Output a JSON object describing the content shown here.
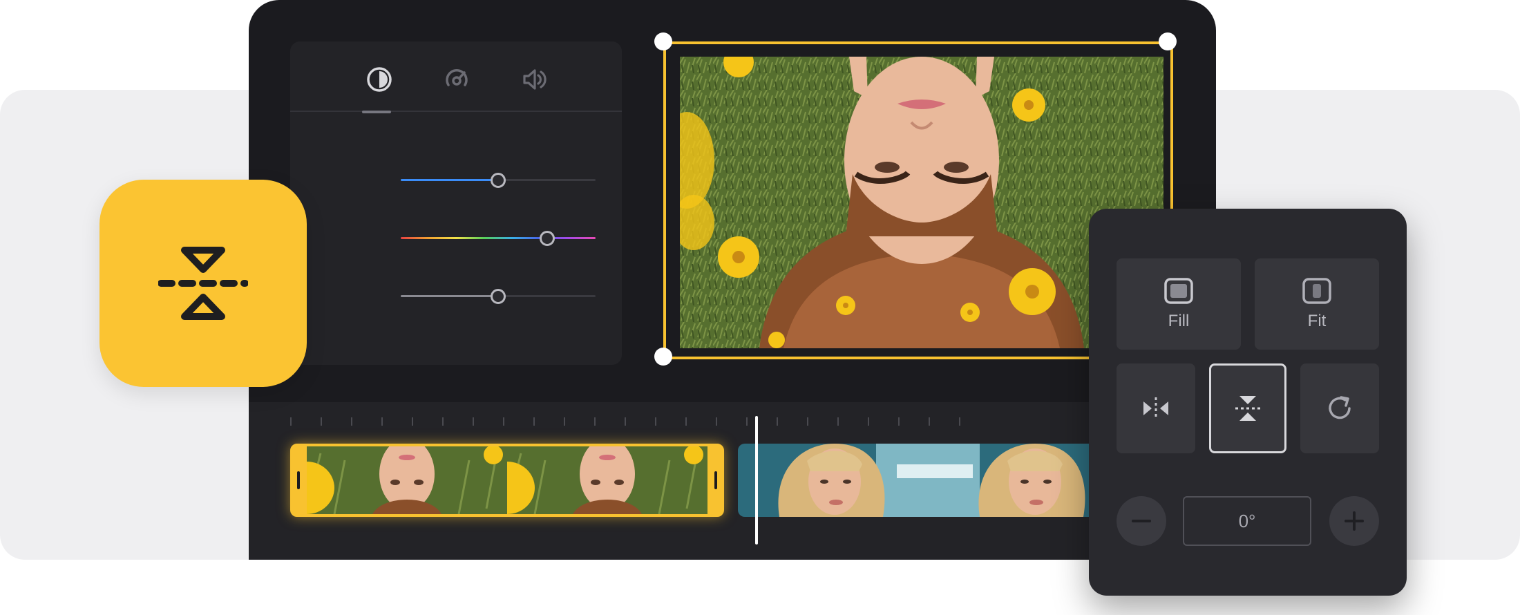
{
  "adjust_panel": {
    "tabs": [
      {
        "icon": "contrast-icon",
        "active": true
      },
      {
        "icon": "speed-icon",
        "active": false
      },
      {
        "icon": "volume-icon",
        "active": false
      }
    ],
    "sliders": [
      {
        "name": "blue-slider",
        "value": 0.5,
        "accent": "#3b8cf7"
      },
      {
        "name": "hue-slider",
        "value": 0.75,
        "accent": "gradient"
      },
      {
        "name": "gray-slider",
        "value": 0.5,
        "accent": "#8a8a92"
      }
    ]
  },
  "app_icon": {
    "icon": "flip-vertical-icon",
    "color": "#fbc432"
  },
  "transform_panel": {
    "fill_label": "Fill",
    "fit_label": "Fit",
    "flip_horizontal_icon": "flip-horizontal-icon",
    "flip_vertical_icon": "flip-vertical-icon",
    "rotate_icon": "rotate-icon",
    "minus_icon": "minus-icon",
    "plus_icon": "plus-icon",
    "angle_value": "0°"
  },
  "colors": {
    "accent": "#f8c230",
    "panel": "#29292e",
    "device": "#1b1b1f"
  }
}
